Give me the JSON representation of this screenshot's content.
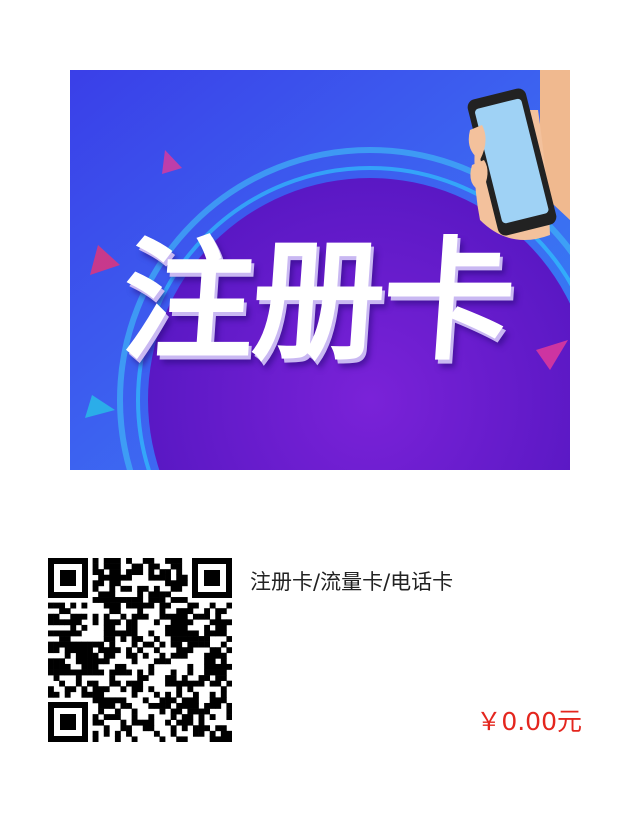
{
  "banner": {
    "title": "注册卡",
    "colors": {
      "background": "#3f4ff0",
      "disc": "#6a1fd1",
      "ring": "#2aa8f0"
    }
  },
  "product": {
    "name": "注册卡/流量卡/电话卡",
    "price": "￥0.00元"
  },
  "qr": {
    "icon": "qr-code-icon"
  },
  "colors": {
    "price": "#e4261e"
  }
}
